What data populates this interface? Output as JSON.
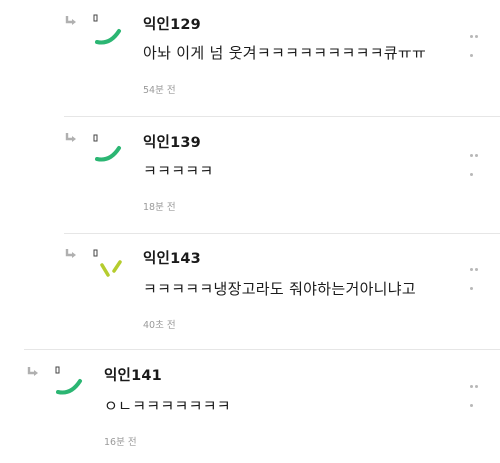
{
  "comments": [
    {
      "name": "익인129",
      "text": "아놔 이게 넘 웃겨ㅋㅋㅋㅋㅋㅋㅋㅋㅋ큐ㅠㅠ",
      "time": "54분 전",
      "accent": "#2bb673",
      "icon": "reply-arrow-icon"
    },
    {
      "name": "익인139",
      "text": "ㅋㅋㅋㅋㅋ",
      "time": "18분 전",
      "accent": "#2bb673",
      "icon": "reply-arrow-icon"
    },
    {
      "name": "익인143",
      "text": "ㅋㅋㅋㅋㅋ냉장고라도 줘야하는거아니냐고",
      "time": "40초 전",
      "accent": "#b5cc2e",
      "icon": "reply-arrow-icon"
    },
    {
      "name": "익인141",
      "text": "ㅇㄴㅋㅋㅋㅋㅋㅋㅋ",
      "time": "16분 전",
      "accent": "#2bb673",
      "icon": "reply-arrow-icon"
    }
  ],
  "colors": {
    "muted": "#9a9a9a",
    "divider": "#e6e6e6",
    "arrow": "#b0b0b0"
  }
}
